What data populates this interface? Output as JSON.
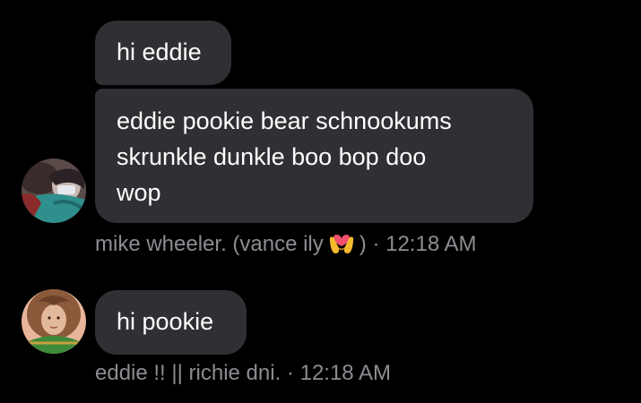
{
  "messages": [
    {
      "text": "hi eddie"
    },
    {
      "text": "eddie pookie bear schnookums\nskrunkle dunkle boo bop doo\nwop"
    },
    {
      "text": "hi pookie"
    }
  ],
  "groups": [
    {
      "author_prefix": "mike wheeler. (vance ily",
      "author_emoji": "heart-hands-emoji",
      "author_suffix": ")",
      "separator": "·",
      "time": "12:18 AM",
      "avatar_icon": "user-avatar-photo"
    },
    {
      "author": "eddie !! || richie dni.",
      "separator": "·",
      "time": "12:18 AM",
      "avatar_icon": "user-avatar-photo"
    }
  ],
  "colors": {
    "background": "#000000",
    "bubble": "#2f3033",
    "message_text": "#ffffff",
    "meta_text": "#8b8d92"
  }
}
